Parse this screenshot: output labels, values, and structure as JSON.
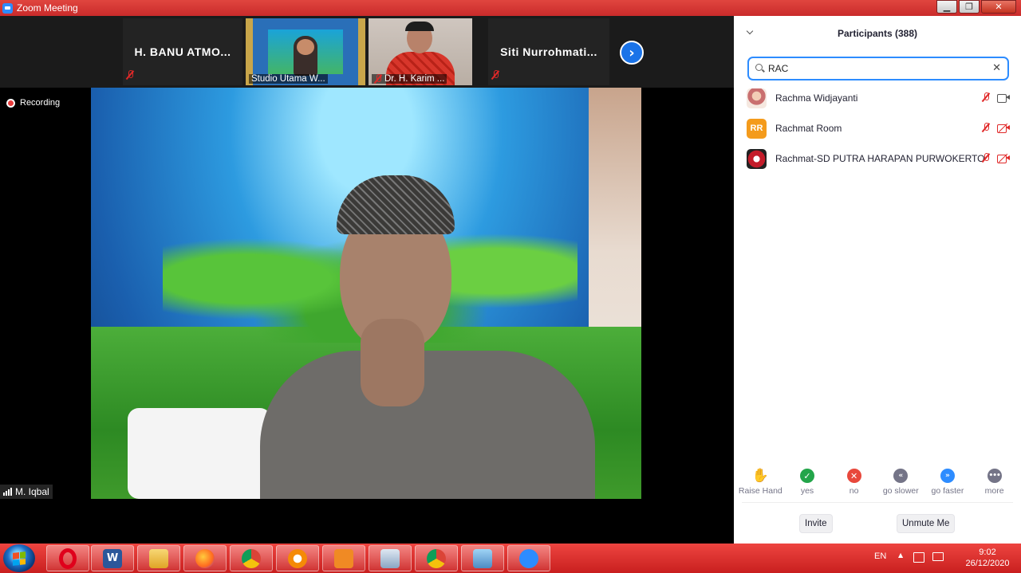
{
  "window": {
    "title": "Zoom Meeting",
    "min_label": "▁",
    "max_label": "❐",
    "close_label": "✕"
  },
  "thumbnails": [
    {
      "name": "H. BANU ATMO...",
      "video": false
    },
    {
      "name": "Studio Utama W...",
      "video": true
    },
    {
      "name": "Dr. H. Karim ...",
      "video": true
    },
    {
      "name": "Siti  Nurrohmati...",
      "video": false
    }
  ],
  "next_arrow": "›",
  "main": {
    "recording_label": "Recording",
    "active_speaker": "M. Iqbal"
  },
  "participants": {
    "header": "Participants (388)",
    "search_value": "RAC",
    "clear_label": "✕",
    "list": [
      {
        "name": "Rachma Widjayanti",
        "avatar": "photo",
        "initials": "",
        "muted": true,
        "video_off": false
      },
      {
        "name": "Rachmat Room",
        "avatar": "initials",
        "initials": "RR",
        "muted": true,
        "video_off": true
      },
      {
        "name": "Rachmat-SD PUTRA HARAPAN PURWOKERTO",
        "avatar": "logo",
        "initials": "",
        "muted": true,
        "video_off": true
      }
    ],
    "reactions": [
      {
        "label": "Raise Hand",
        "glyph": "✋"
      },
      {
        "label": "yes",
        "glyph": "✓"
      },
      {
        "label": "no",
        "glyph": "✕"
      },
      {
        "label": "go slower",
        "glyph": "«"
      },
      {
        "label": "go faster",
        "glyph": "»"
      },
      {
        "label": "more",
        "glyph": "•••"
      }
    ],
    "invite_label": "Invite",
    "unmute_label": "Unmute Me"
  },
  "taskbar": {
    "apps": [
      "opera-icon",
      "word-icon",
      "file-explorer-icon",
      "firefox-icon",
      "chrome-icon",
      "avast-icon",
      "media-player-icon",
      "network-icon",
      "chrome-profile-icon",
      "photos-icon",
      "zoom-icon"
    ],
    "word_glyph": "W",
    "language": "EN",
    "up_glyph": "▲",
    "time": "9:02",
    "date": "26/12/2020"
  },
  "colors": {
    "titlebar": "#d83a35",
    "accent": "#2d8cff",
    "muted_red": "#e02828"
  }
}
